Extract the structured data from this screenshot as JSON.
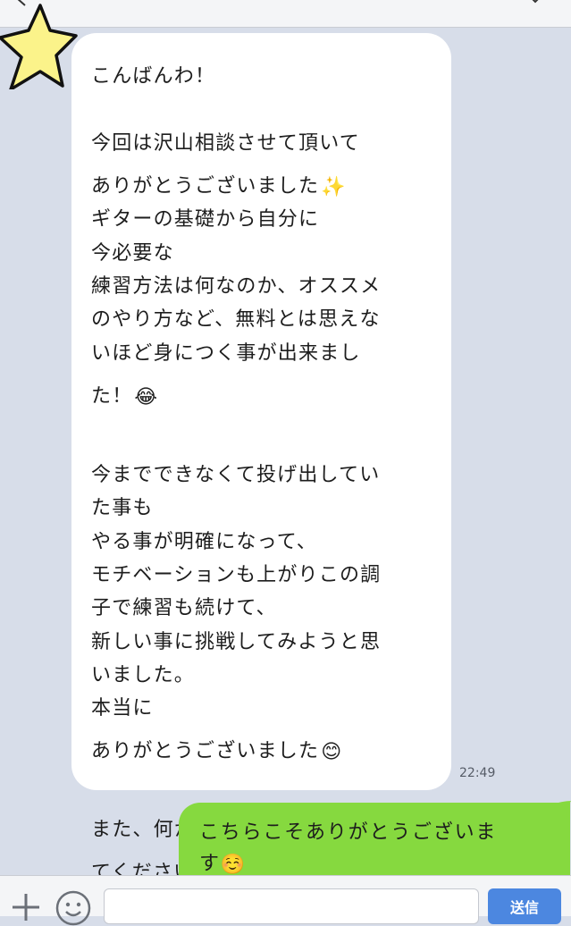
{
  "colors": {
    "chat_background": "#d7dde9",
    "incoming_bubble": "#ffffff",
    "outgoing_bubble": "#86d93f",
    "send_button": "#4c87e0"
  },
  "header": {
    "back_icon": "chevron-left-icon",
    "menu_icon": "chevron-down-icon"
  },
  "contact": {
    "avatar_icon": "star-icon"
  },
  "messages": {
    "incoming": {
      "lines": [
        {
          "text": "こんばんわ！",
          "emoji": ""
        },
        {
          "text": "",
          "emoji": ""
        },
        {
          "text": "今回は沢山相談させて頂いて",
          "emoji": ""
        },
        {
          "text": "ありがとうございました",
          "emoji": "✨"
        },
        {
          "text": "ギターの基礎から自分に",
          "emoji": ""
        },
        {
          "text": "今必要な",
          "emoji": ""
        },
        {
          "text": "練習方法は何なのか、オススメ",
          "emoji": ""
        },
        {
          "text": "のやり方など、無料とは思えな",
          "emoji": ""
        },
        {
          "text": "いほど身につく事が出来まし",
          "emoji": ""
        },
        {
          "text": "た！",
          "emoji": "😂"
        },
        {
          "text": "",
          "emoji": ""
        },
        {
          "text": "今までできなくて投げ出してい",
          "emoji": ""
        },
        {
          "text": "た事も",
          "emoji": ""
        },
        {
          "text": "やる事が明確になって、",
          "emoji": ""
        },
        {
          "text": "モチベーションも上がりこの調",
          "emoji": ""
        },
        {
          "text": "子で練習も続けて、",
          "emoji": ""
        },
        {
          "text": "新しい事に挑戦してみようと思",
          "emoji": ""
        },
        {
          "text": "いました。",
          "emoji": ""
        },
        {
          "text": "本当に",
          "emoji": ""
        },
        {
          "text": "ありがとうございました",
          "emoji": "😊"
        },
        {
          "text": "",
          "emoji": ""
        },
        {
          "text": "また、何かあれば是非質問させ",
          "emoji": ""
        },
        {
          "text": "てください！",
          "emoji": "☺️"
        }
      ],
      "time": "22:49"
    },
    "outgoing": {
      "lines": [
        {
          "text": "こちらこそありがとうございま",
          "emoji": ""
        },
        {
          "text": "す",
          "emoji": "☺️"
        }
      ]
    }
  },
  "input_bar": {
    "plus_icon": "plus-icon",
    "sticker_icon": "smiley-icon",
    "input_value": "",
    "send_label": "送信"
  }
}
